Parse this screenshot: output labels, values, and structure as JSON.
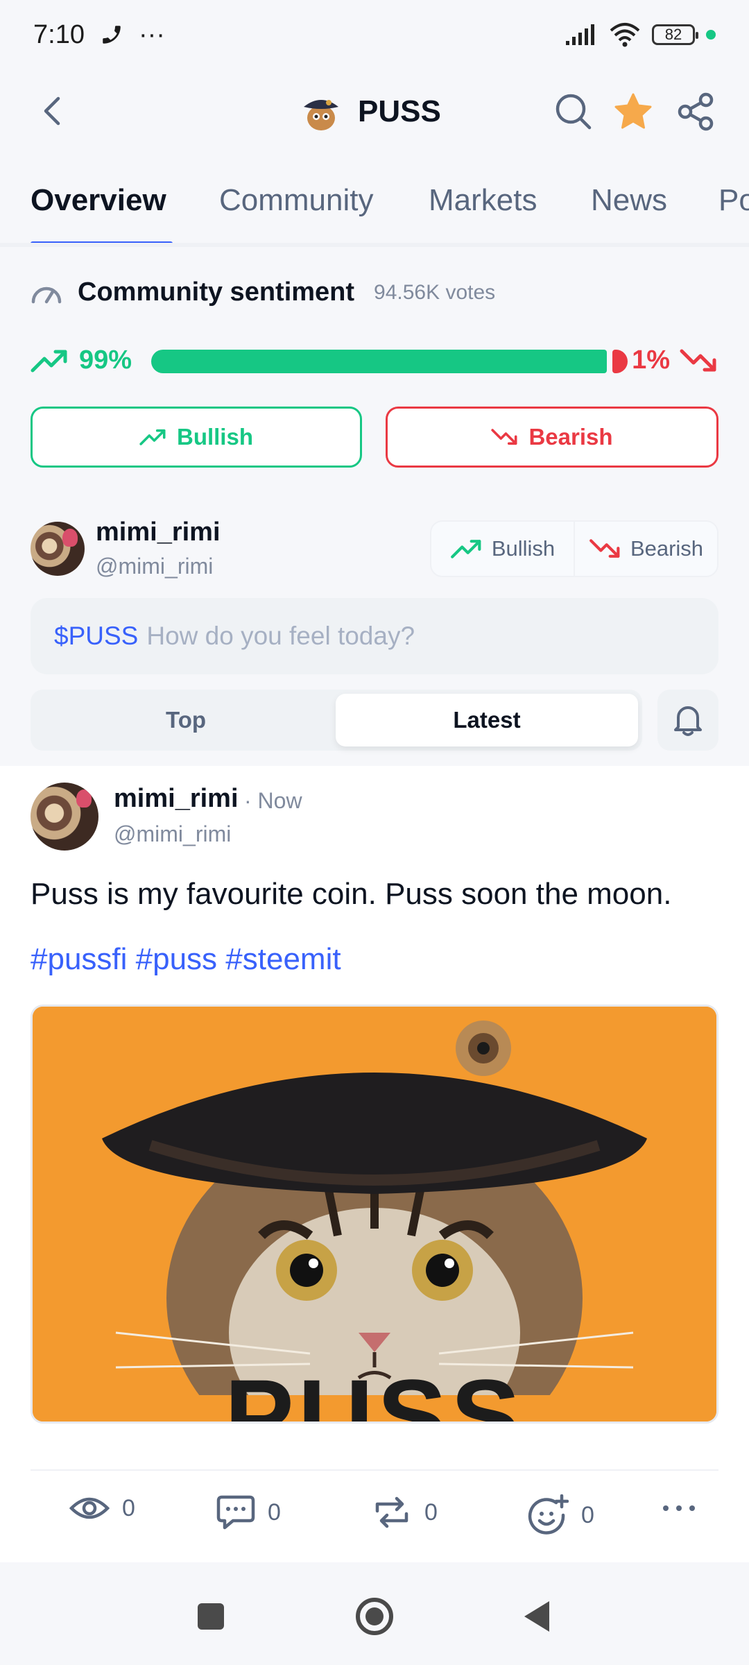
{
  "status_bar": {
    "time": "7:10",
    "more": "···",
    "battery": "82",
    "icons": [
      "phone-icon",
      "signal-icon",
      "wifi-icon",
      "battery-icon"
    ]
  },
  "header": {
    "title": "PUSS",
    "icons": [
      "back-icon",
      "search-icon",
      "star-icon",
      "share-icon"
    ],
    "star_color": "#f6a94b"
  },
  "tabs": [
    "Overview",
    "Community",
    "Markets",
    "News",
    "Po"
  ],
  "sentiment": {
    "title": "Community sentiment",
    "votes": "94.56K votes",
    "bullish_pct": "99%",
    "bearish_pct": "1%",
    "bullish_fraction": 0.99,
    "bullish_button": "Bullish",
    "bearish_button": "Bearish"
  },
  "composer": {
    "username": "mimi_rimi",
    "handle": "@mimi_rimi",
    "bullish": "Bullish",
    "bearish": "Bearish",
    "ticker": "$PUSS",
    "placeholder": "How do you feel today?"
  },
  "feed_sort": {
    "options": [
      "Top",
      "Latest"
    ],
    "selected": "Latest"
  },
  "post": {
    "username": "mimi_rimi",
    "time": "· Now",
    "handle": "@mimi_rimi",
    "text": "Puss is my favourite coin. Puss soon the moon.",
    "tags": "#pussfi #puss #steemit",
    "image_text": "PUSS",
    "views": "0",
    "comments": "0",
    "reposts": "0",
    "reactions": "0"
  },
  "colors": {
    "accent": "#3861fb",
    "bullish": "#16c784",
    "bearish": "#ea3943"
  }
}
